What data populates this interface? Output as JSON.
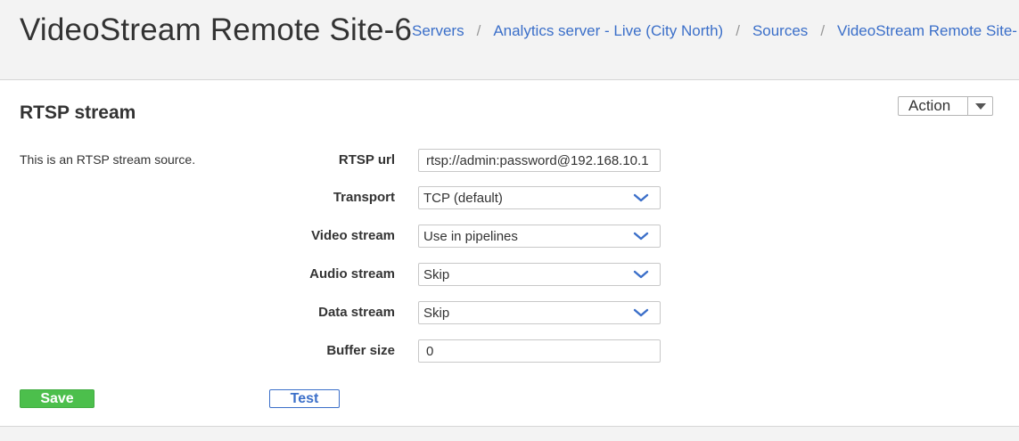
{
  "header": {
    "title": "VideoStream Remote Site-6",
    "breadcrumbs": [
      {
        "label": "Servers"
      },
      {
        "label": "Analytics server - Live (City North)"
      },
      {
        "label": "Sources"
      },
      {
        "label": "VideoStream Remote Site-"
      }
    ],
    "separator": "/"
  },
  "section": {
    "title": "RTSP stream",
    "action_label": "Action",
    "description": "This is an RTSP stream source."
  },
  "form": {
    "rtsp_url": {
      "label": "RTSP url",
      "value": "rtsp://admin:password@192.168.10.1"
    },
    "transport": {
      "label": "Transport",
      "value": "TCP (default)"
    },
    "video_stream": {
      "label": "Video stream",
      "value": "Use in pipelines"
    },
    "audio_stream": {
      "label": "Audio stream",
      "value": "Skip"
    },
    "data_stream": {
      "label": "Data stream",
      "value": "Skip"
    },
    "buffer_size": {
      "label": "Buffer size",
      "value": "0"
    }
  },
  "buttons": {
    "save_label": "Save",
    "test_label": "Test"
  },
  "colors": {
    "link": "#3b6fc9",
    "save_green": "#4cbf4c",
    "header_bg": "#f3f3f3"
  },
  "icons": {
    "select_chevron": "chevron-down-icon",
    "action_caret": "caret-down-icon"
  }
}
